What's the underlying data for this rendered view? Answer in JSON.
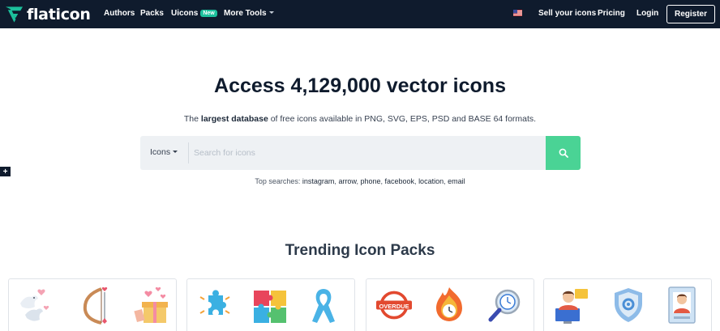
{
  "header": {
    "logo_text": "flaticon",
    "nav": {
      "authors": "Authors",
      "packs": "Packs",
      "uicons": "Uicons",
      "uicons_badge": "New",
      "more_tools": "More Tools"
    },
    "sell": "Sell your icons",
    "pricing": "Pricing",
    "login": "Login",
    "register": "Register",
    "brand_color": "#0f1b2d"
  },
  "hero": {
    "title": "Access 4,129,000 vector icons",
    "subtitle_pre": "The ",
    "subtitle_bold": "largest database",
    "subtitle_post": " of free icons available in PNG, SVG, EPS, PSD and BASE 64 formats."
  },
  "search": {
    "type_label": "Icons",
    "placeholder": "Search for icons",
    "value": "",
    "button_color": "#4ad395"
  },
  "top_searches": {
    "label": "Top searches:",
    "items": [
      "instagram",
      "arrow",
      "phone",
      "facebook",
      "location",
      "email"
    ]
  },
  "side_tab": {
    "label": "+"
  },
  "trending": {
    "title": "Trending Icon Packs",
    "overdue_label": "OVERDUE",
    "packs": [
      {
        "icons": [
          "doves-icon",
          "bow-and-arrow-icon",
          "gift-box-hearts-icon"
        ]
      },
      {
        "icons": [
          "puzzle-piece-icon",
          "puzzle-pieces-icon",
          "awareness-ribbon-icon"
        ]
      },
      {
        "icons": [
          "overdue-stamp-icon",
          "burning-clock-icon",
          "magnifier-clock-icon"
        ]
      },
      {
        "icons": [
          "support-agent-icon",
          "security-shield-icon",
          "employee-badge-icon"
        ]
      }
    ]
  }
}
